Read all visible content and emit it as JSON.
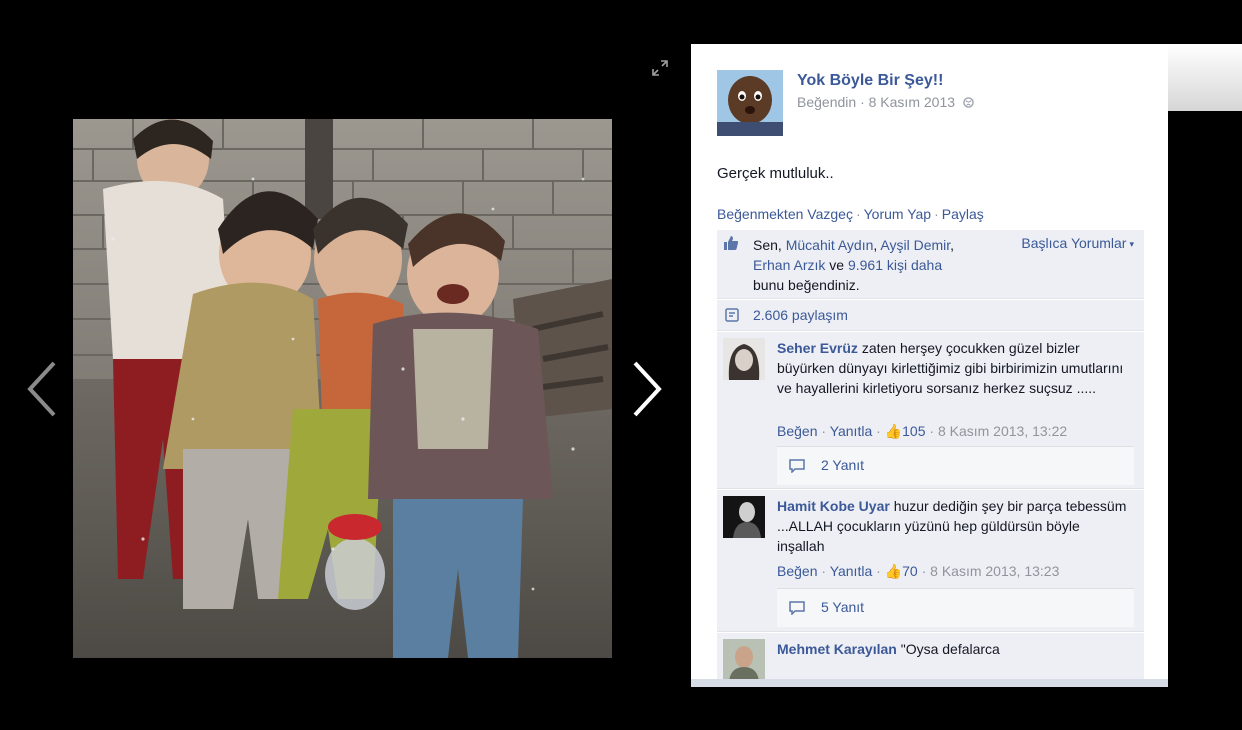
{
  "viewer": {
    "expand_icon": "expand-arrows-icon",
    "prev_icon": "chevron-left-icon",
    "next_icon": "chevron-right-icon",
    "photo_description": "photo-of-four-laughing-children"
  },
  "post": {
    "page_name": "Yok Böyle Bir Şey!!",
    "meta_liked": "Beğendin",
    "meta_sep": "·",
    "meta_date": "8 Kasım 2013",
    "caption": "Gerçek mutluluk..",
    "actions": {
      "unlike": "Beğenmekten Vazgeç",
      "comment": "Yorum Yap",
      "share": "Paylaş",
      "sep": "·"
    }
  },
  "likes": {
    "prefix": "Sen, ",
    "name1": "Mücahit Aydın",
    "comma": ", ",
    "name2": "Ayşil Demir",
    "name3": "Erhan Arzık",
    "and": " ve ",
    "others": "9.961 kişi daha",
    "suffix": " bunu beğendiniz.",
    "sort_label": "Başlıca Yorumlar"
  },
  "shares": {
    "label": "2.606 paylaşım"
  },
  "comments": [
    {
      "author": "Seher Evrüz",
      "text": " zaten herşey çocukken güzel bizler büyürken dünyayı kirlettiğimiz gibi birbirimizin umutlarını ve hayallerini kirletiyoru sorsanız herkez suçsuz .....",
      "like": "Beğen",
      "reply": "Yanıtla",
      "likes": "105",
      "date": "8 Kasım 2013, 13:22",
      "replies": "2 Yanıt"
    },
    {
      "author": "Hamit Kobe Uyar",
      "text": " huzur dediğin şey bir parça tebessüm ...ALLAH çocukların yüzünü hep güldürsün böyle inşallah",
      "like": "Beğen",
      "reply": "Yanıtla",
      "likes": "70",
      "date": "8 Kasım 2013, 13:23",
      "replies": "5 Yanıt"
    },
    {
      "author": "Mehmet Karayılan",
      "text": " \"Oysa defalarca"
    }
  ],
  "colors": {
    "link": "#3b5998",
    "muted": "#90949c",
    "ufi_bg": "#edeff4"
  }
}
